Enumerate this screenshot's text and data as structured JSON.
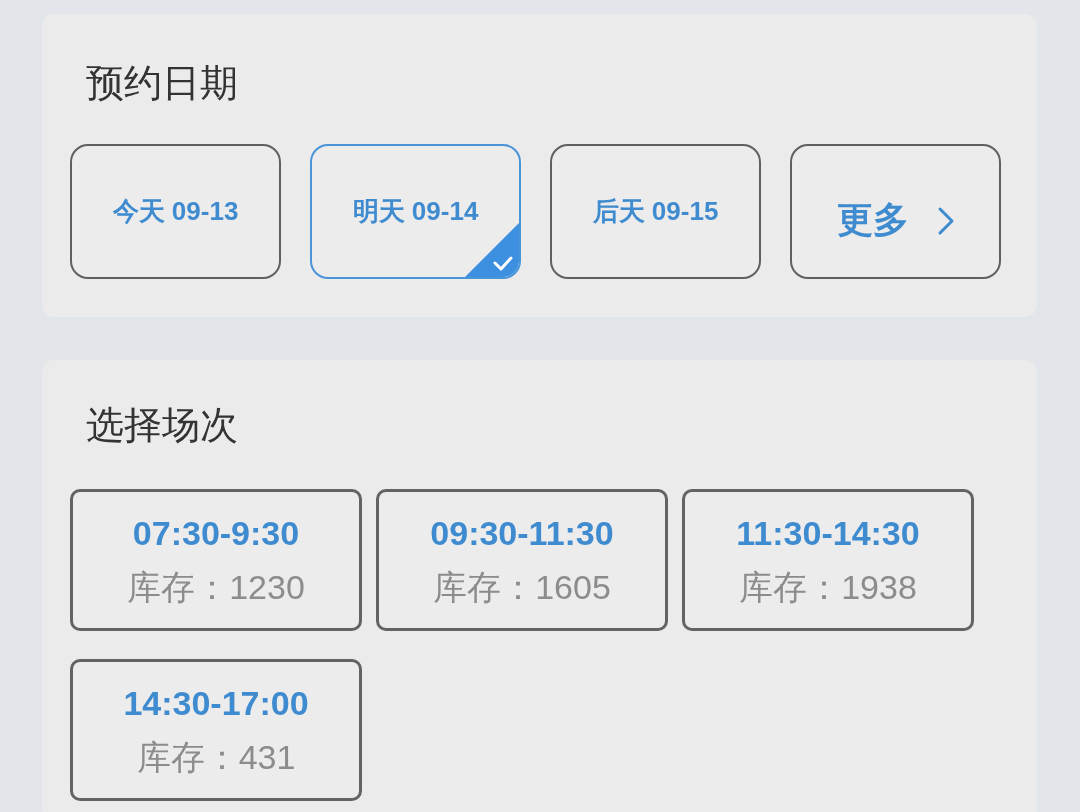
{
  "date_section": {
    "title": "预约日期",
    "dates": [
      {
        "label": "今天 09-13",
        "selected": false
      },
      {
        "label": "明天 09-14",
        "selected": true
      },
      {
        "label": "后天 09-15",
        "selected": false
      }
    ],
    "more": {
      "label": "更多"
    }
  },
  "session_section": {
    "title": "选择场次",
    "slots": [
      {
        "time": "07:30-9:30",
        "stock": "库存：1230",
        "selected": false
      },
      {
        "time": "09:30-11:30",
        "stock": "库存：1605",
        "selected": false
      },
      {
        "time": "11:30-14:30",
        "stock": "库存：1938",
        "selected": false
      },
      {
        "time": "14:30-17:00",
        "stock": "库存：431",
        "selected": false
      }
    ]
  }
}
